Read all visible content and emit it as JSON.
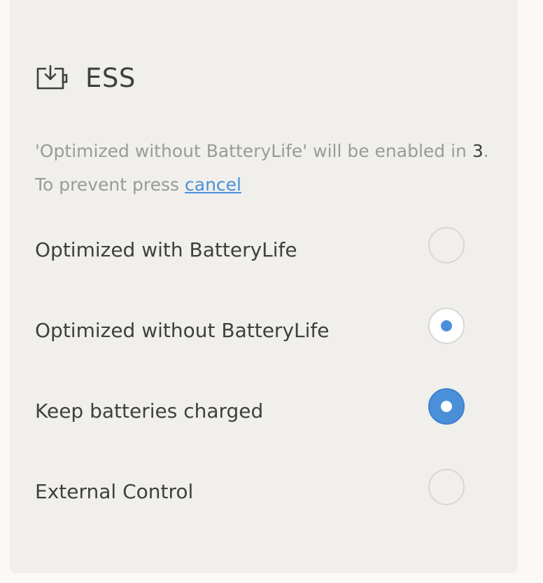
{
  "panel": {
    "title": "ESS",
    "icon": "battery-download-icon"
  },
  "notice": {
    "prefix": "'Optimized without BatteryLife' will be enabled in ",
    "countdown": "3",
    "middle": ". To prevent press ",
    "cancel_label": "cancel"
  },
  "options": [
    {
      "label": "Optimized with BatteryLife",
      "state": "unselected"
    },
    {
      "label": "Optimized without BatteryLife",
      "state": "pending"
    },
    {
      "label": "Keep batteries charged",
      "state": "selected"
    },
    {
      "label": "External Control",
      "state": "unselected"
    }
  ],
  "colors": {
    "accent": "#4a90d9",
    "card_background": "#f0efec",
    "text": "#3f3f3f",
    "muted_text": "#9a9a97"
  }
}
